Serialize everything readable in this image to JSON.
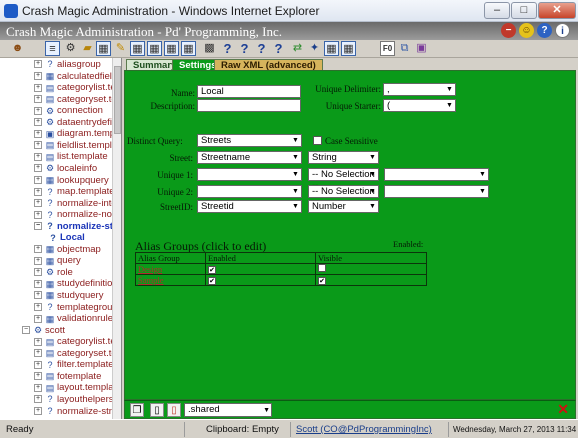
{
  "window": {
    "title": "Crash Magic Administration - Windows Internet Explorer",
    "min_label": "–",
    "max_label": "□",
    "close_label": "✕"
  },
  "app": {
    "title": "Crash Magic Administration - Pd' Programming, Inc.",
    "toolbar_f0": "F0"
  },
  "tree": {
    "items": [
      {
        "label": "aliasgroup",
        "expand": "+",
        "icon": "?"
      },
      {
        "label": "calculatedfields",
        "expand": "+",
        "icon": "▦"
      },
      {
        "label": "categorylist.temp",
        "expand": "+",
        "icon": "▤"
      },
      {
        "label": "categoryset.temp",
        "expand": "+",
        "icon": "▤"
      },
      {
        "label": "connection",
        "expand": "+",
        "icon": "⚙"
      },
      {
        "label": "dataentrydefiniti",
        "expand": "+",
        "icon": "⚙"
      },
      {
        "label": "diagram.template",
        "expand": "+",
        "icon": "▣"
      },
      {
        "label": "fieldlist.template",
        "expand": "+",
        "icon": "▤"
      },
      {
        "label": "list.template",
        "expand": "+",
        "icon": "▤"
      },
      {
        "label": "localeinfo",
        "expand": "+",
        "icon": "⚙"
      },
      {
        "label": "lookupquery",
        "expand": "+",
        "icon": "▦"
      },
      {
        "label": "map.template",
        "expand": "+",
        "icon": "?"
      },
      {
        "label": "normalize-interse",
        "expand": "+",
        "icon": "?"
      },
      {
        "label": "normalize-nodes",
        "expand": "+",
        "icon": "?"
      },
      {
        "label": "normalize-stree",
        "expand": "−",
        "icon": "?",
        "selected": true
      },
      {
        "label": "Local",
        "expand": "",
        "icon": "?",
        "child": true,
        "selected": true
      },
      {
        "label": "objectmap",
        "expand": "+",
        "icon": "▦"
      },
      {
        "label": "query",
        "expand": "+",
        "icon": "▦"
      },
      {
        "label": "role",
        "expand": "+",
        "icon": "⚙"
      },
      {
        "label": "studydefinition",
        "expand": "+",
        "icon": "▦"
      },
      {
        "label": "studyquery",
        "expand": "+",
        "icon": "▦"
      },
      {
        "label": "templategroup",
        "expand": "+",
        "icon": "?"
      },
      {
        "label": "validationrules",
        "expand": "+",
        "icon": "▦"
      },
      {
        "label": "scott",
        "expand": "−",
        "icon": "⚙",
        "root": true
      },
      {
        "label": "categorylist.temp",
        "expand": "+",
        "icon": "▤"
      },
      {
        "label": "categoryset.temp",
        "expand": "+",
        "icon": "▤"
      },
      {
        "label": "filter.template",
        "expand": "+",
        "icon": "?"
      },
      {
        "label": "fotemplate",
        "expand": "+",
        "icon": "▤"
      },
      {
        "label": "layout.template",
        "expand": "+",
        "icon": "▤"
      },
      {
        "label": "layouthelpers",
        "expand": "+",
        "icon": "?"
      },
      {
        "label": "normalize-streets",
        "expand": "+",
        "icon": "?"
      }
    ]
  },
  "tabs": [
    {
      "label": "Summary",
      "active": false
    },
    {
      "label": "Settings",
      "active": true
    },
    {
      "label": "Raw XML (advanced)",
      "active": false
    }
  ],
  "form": {
    "name_label": "Name:",
    "name_value": "Local",
    "description_label": "Description:",
    "description_value": "",
    "unique_delimiter_label": "Unique Delimiter:",
    "unique_delimiter_value": ",",
    "unique_starter_label": "Unique Starter:",
    "unique_starter_value": "(",
    "distinct_query_label": "Distinct Query:",
    "distinct_query_value": "Streets",
    "case_sensitive_label": "Case Sensitive",
    "street_label": "Street:",
    "street_field": "Streetname",
    "street_type": "String",
    "unique1_label": "Unique 1:",
    "unique1_field": "",
    "unique1_type": "-- No Selection --",
    "unique1_extra": "",
    "unique2_label": "Unique 2:",
    "unique2_field": "",
    "unique2_type": "-- No Selection --",
    "unique2_extra": "",
    "streetid_label": "StreetID:",
    "streetid_field": "Streetid",
    "streetid_type": "Number"
  },
  "alias": {
    "title": "Alias Groups (click to edit)",
    "enabled_header": "Enabled:",
    "col_group": "Alias Group",
    "col_enabled": "Enabled",
    "col_visible": "Visible",
    "rows": [
      {
        "group": "Design",
        "enabled": "✔",
        "visible": ""
      },
      {
        "group": "Sample",
        "enabled": "✔",
        "visible": "✔"
      }
    ]
  },
  "bottom": {
    "shared_value": ".shared",
    "delete_label": "✕"
  },
  "status": {
    "ready": "Ready",
    "clipboard": "Clipboard: Empty",
    "user": "Scott (CO@PdProgrammingInc)",
    "datetime": "Wednesday, March 27, 2013 11:34 AM"
  },
  "colors": {
    "panel_green": "#0a9a19",
    "tree_text": "#8b1d1d",
    "link_red": "#b02b2b"
  }
}
